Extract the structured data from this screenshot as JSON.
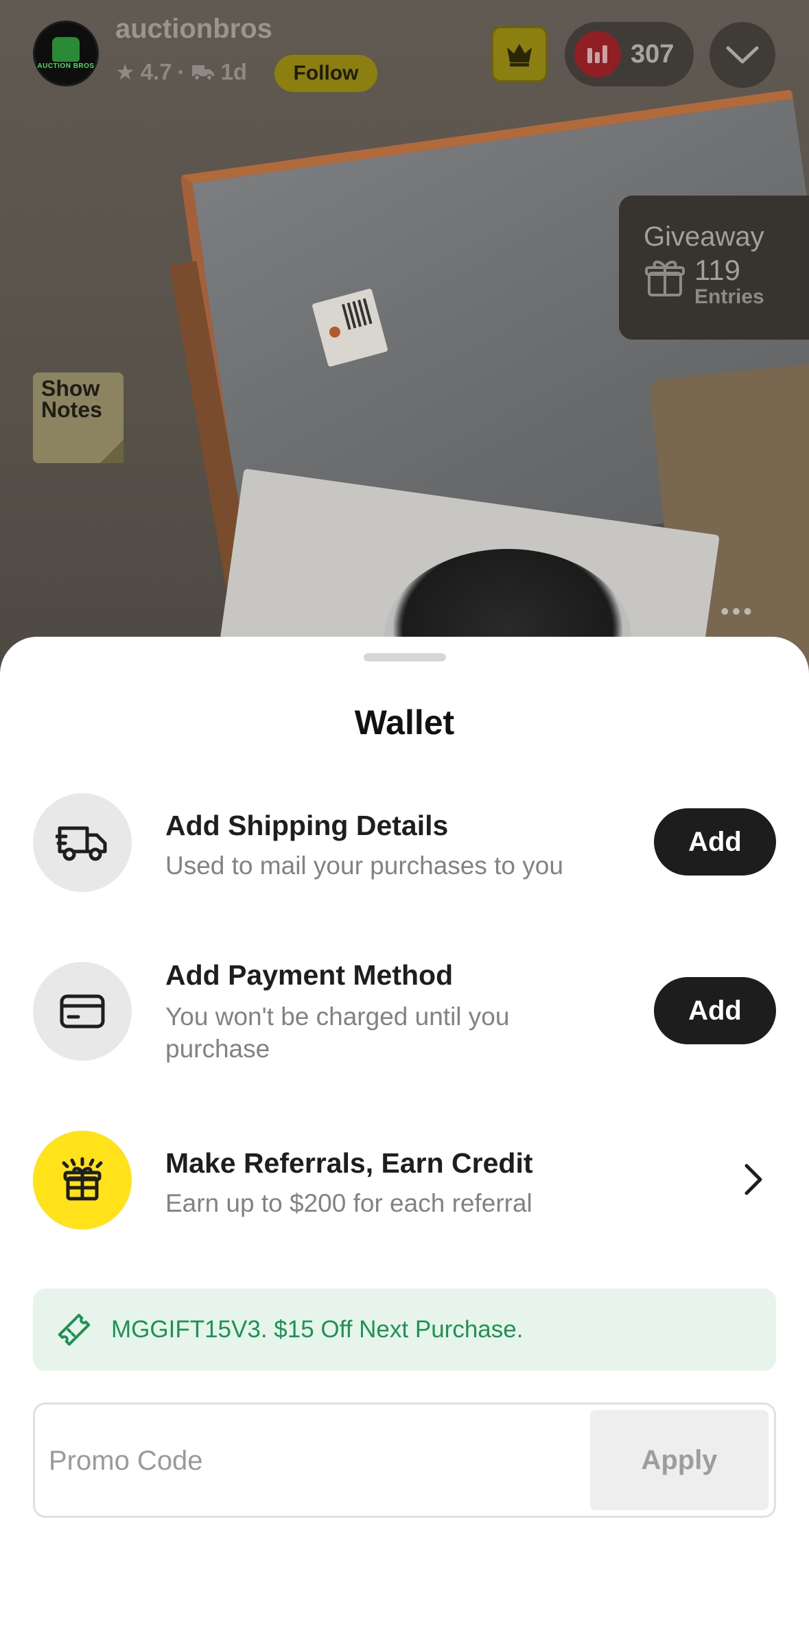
{
  "stream": {
    "streamer_name": "auctionbros",
    "avatar_text": "AUCTION BROS",
    "rating": "4.7",
    "separator": "·",
    "shipping_time": "1d",
    "follow_label": "Follow",
    "viewer_count": "307",
    "giveaway": {
      "title": "Giveaway",
      "count": "119",
      "entries_label": "Entries"
    },
    "show_notes_label": "Show Notes",
    "more_label": "•••"
  },
  "wallet": {
    "title": "Wallet",
    "items": [
      {
        "title": "Add Shipping Details",
        "subtitle": "Used to mail your purchases to you",
        "action_label": "Add",
        "icon": "truck-icon"
      },
      {
        "title": "Add Payment Method",
        "subtitle": "You won't be charged until you purchase",
        "action_label": "Add",
        "icon": "credit-card-icon"
      },
      {
        "title": "Make Referrals, Earn Credit",
        "subtitle": "Earn up to $200 for each referral",
        "icon": "gift-icon"
      }
    ],
    "promo_banner": "MGGIFT15V3. $15 Off Next Purchase.",
    "promo_placeholder": "Promo Code",
    "apply_label": "Apply"
  },
  "colors": {
    "accent_yellow": "#ffe21a",
    "dark_button": "#1d1d1d",
    "promo_green": "#1e9153",
    "promo_bg": "#e6f4ec"
  }
}
